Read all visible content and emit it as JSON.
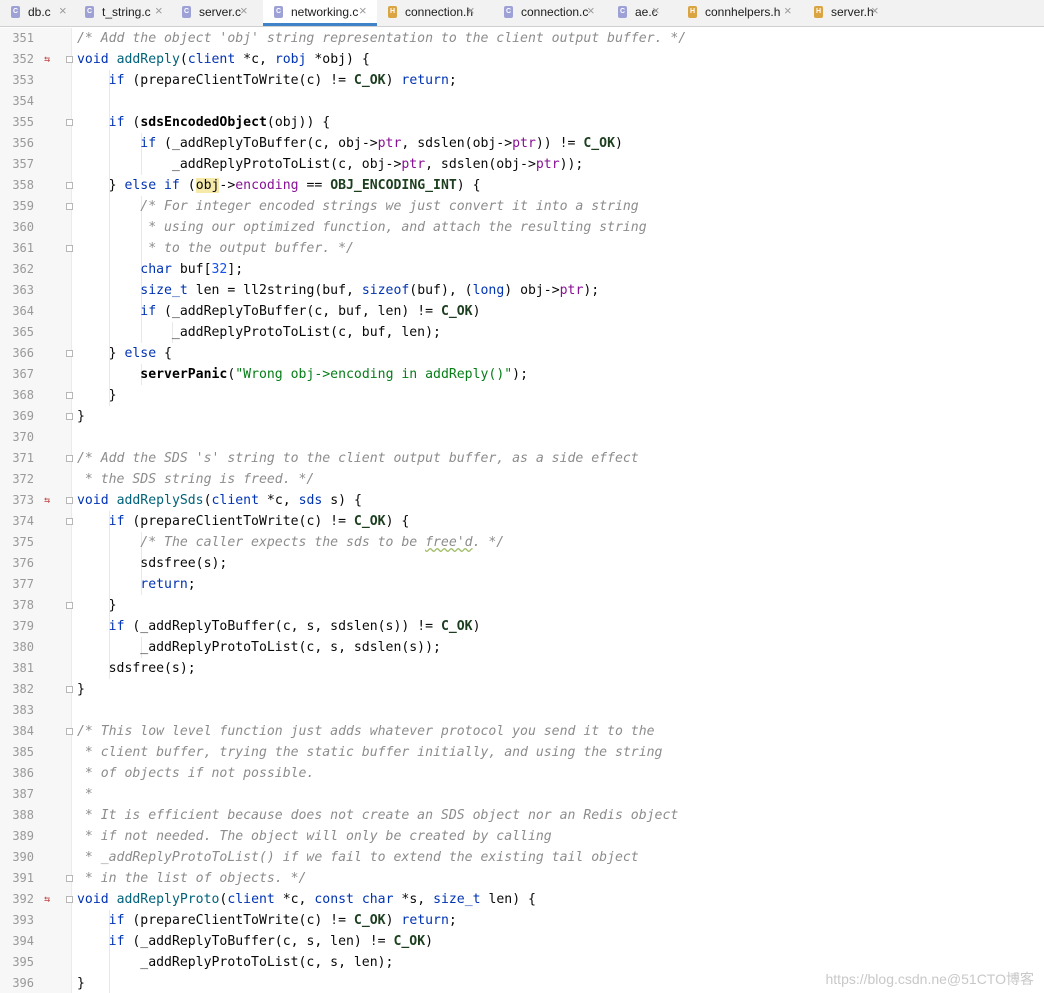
{
  "tabs": [
    {
      "name": "db.c",
      "type": "c",
      "active": false
    },
    {
      "name": "t_string.c",
      "type": "c",
      "active": false
    },
    {
      "name": "server.c",
      "type": "c",
      "active": false
    },
    {
      "name": "networking.c",
      "type": "c",
      "active": true
    },
    {
      "name": "connection.h",
      "type": "h",
      "active": false
    },
    {
      "name": "connection.c",
      "type": "c",
      "active": false
    },
    {
      "name": "ae.c",
      "type": "c",
      "active": false
    },
    {
      "name": "connhelpers.h",
      "type": "h",
      "active": false
    },
    {
      "name": "server.h",
      "type": "h",
      "active": false
    }
  ],
  "tab_close_glyph": "×",
  "file_type_letters": {
    "c": "C",
    "h": "H"
  },
  "gutter": {
    "override_lines": [
      352,
      373,
      392
    ],
    "override_glyph": "⇆",
    "fold_lines": [
      352,
      355,
      358,
      359,
      361,
      366,
      368,
      369,
      371,
      373,
      374,
      378,
      382,
      384,
      391,
      392
    ]
  },
  "indent_guides": [
    {
      "level": 1,
      "from": 353,
      "to": 368
    },
    {
      "level": 2,
      "from": 356,
      "to": 357
    },
    {
      "level": 2,
      "from": 359,
      "to": 365
    },
    {
      "level": 3,
      "from": 365,
      "to": 365
    },
    {
      "level": 2,
      "from": 367,
      "to": 367
    },
    {
      "level": 1,
      "from": 374,
      "to": 381
    },
    {
      "level": 2,
      "from": 375,
      "to": 377
    },
    {
      "level": 2,
      "from": 380,
      "to": 380
    },
    {
      "level": 1,
      "from": 393,
      "to": 396
    }
  ],
  "code_lines": [
    {
      "n": 351,
      "s": [
        [
          "cm",
          "/* Add the object 'obj' string representation to the client output buffer. */"
        ]
      ]
    },
    {
      "n": 352,
      "s": [
        [
          "kw",
          "void "
        ],
        [
          "fn",
          "addReply"
        ],
        [
          "",
          "("
        ],
        [
          "kw",
          "client "
        ],
        [
          "",
          "*c, "
        ],
        [
          "kw",
          "robj "
        ],
        [
          "",
          "*obj) {"
        ]
      ]
    },
    {
      "n": 353,
      "s": [
        [
          "",
          "    "
        ],
        [
          "kw",
          "if "
        ],
        [
          "",
          "(prepareClientToWrite(c) != "
        ],
        [
          "mc",
          "C_OK"
        ],
        [
          "",
          ") "
        ],
        [
          "kw",
          "return"
        ],
        [
          "",
          ";"
        ]
      ]
    },
    {
      "n": 354,
      "s": [
        [
          "",
          ""
        ]
      ]
    },
    {
      "n": 355,
      "s": [
        [
          "",
          "    "
        ],
        [
          "kw",
          "if "
        ],
        [
          "",
          "("
        ],
        [
          "bd",
          "sdsEncodedObject"
        ],
        [
          "",
          "(obj)) {"
        ]
      ]
    },
    {
      "n": 356,
      "s": [
        [
          "",
          "        "
        ],
        [
          "kw",
          "if "
        ],
        [
          "",
          "(_addReplyToBuffer(c, obj->"
        ],
        [
          "fd",
          "ptr"
        ],
        [
          "",
          ", sdslen(obj->"
        ],
        [
          "fd",
          "ptr"
        ],
        [
          "",
          ")) != "
        ],
        [
          "mc",
          "C_OK"
        ],
        [
          "",
          ")"
        ]
      ]
    },
    {
      "n": 357,
      "s": [
        [
          "",
          "            _addReplyProtoToList(c, obj->"
        ],
        [
          "fd",
          "ptr"
        ],
        [
          "",
          ", sdslen(obj->"
        ],
        [
          "fd",
          "ptr"
        ],
        [
          "",
          "));"
        ]
      ]
    },
    {
      "n": 358,
      "s": [
        [
          "",
          "    } "
        ],
        [
          "kw",
          "else if "
        ],
        [
          "",
          "("
        ],
        [
          "hl",
          "obj"
        ],
        [
          "",
          "->"
        ],
        [
          "fd",
          "encoding"
        ],
        [
          "",
          " == "
        ],
        [
          "mc",
          "OBJ_ENCODING_INT"
        ],
        [
          "",
          ") {"
        ]
      ]
    },
    {
      "n": 359,
      "s": [
        [
          "",
          "        "
        ],
        [
          "cm",
          "/* For integer encoded strings we just convert it into a string"
        ]
      ]
    },
    {
      "n": 360,
      "s": [
        [
          "cm",
          "         * using our optimized function, and attach the resulting string"
        ]
      ]
    },
    {
      "n": 361,
      "s": [
        [
          "cm",
          "         * to the output buffer. */"
        ]
      ]
    },
    {
      "n": 362,
      "s": [
        [
          "",
          "        "
        ],
        [
          "kw",
          "char "
        ],
        [
          "",
          "buf["
        ],
        [
          "nm",
          "32"
        ],
        [
          "",
          "];"
        ]
      ]
    },
    {
      "n": 363,
      "s": [
        [
          "",
          "        "
        ],
        [
          "kw",
          "size_t "
        ],
        [
          "",
          "len = ll2string(buf, "
        ],
        [
          "kw",
          "sizeof"
        ],
        [
          "",
          "(buf), ("
        ],
        [
          "kw",
          "long"
        ],
        [
          "",
          ") obj->"
        ],
        [
          "fd",
          "ptr"
        ],
        [
          "",
          ");"
        ]
      ]
    },
    {
      "n": 364,
      "s": [
        [
          "",
          "        "
        ],
        [
          "kw",
          "if "
        ],
        [
          "",
          "(_addReplyToBuffer(c, buf, len) != "
        ],
        [
          "mc",
          "C_OK"
        ],
        [
          "",
          ")"
        ]
      ]
    },
    {
      "n": 365,
      "s": [
        [
          "",
          "            _addReplyProtoToList(c, buf, len);"
        ]
      ]
    },
    {
      "n": 366,
      "s": [
        [
          "",
          "    } "
        ],
        [
          "kw",
          "else "
        ],
        [
          "",
          "{"
        ]
      ]
    },
    {
      "n": 367,
      "s": [
        [
          "",
          "        "
        ],
        [
          "bd",
          "serverPanic"
        ],
        [
          "",
          "("
        ],
        [
          "st",
          "\"Wrong obj->encoding in addReply()\""
        ],
        [
          "",
          ");"
        ]
      ]
    },
    {
      "n": 368,
      "s": [
        [
          "",
          "    }"
        ]
      ]
    },
    {
      "n": 369,
      "s": [
        [
          "",
          "}"
        ]
      ]
    },
    {
      "n": 370,
      "s": [
        [
          "",
          ""
        ]
      ]
    },
    {
      "n": 371,
      "s": [
        [
          "cm",
          "/* Add the SDS 's' string to the client output buffer, as a side effect"
        ]
      ]
    },
    {
      "n": 372,
      "s": [
        [
          "cm",
          " * the SDS string is freed. */"
        ]
      ]
    },
    {
      "n": 373,
      "s": [
        [
          "kw",
          "void "
        ],
        [
          "fn",
          "addReplySds"
        ],
        [
          "",
          "("
        ],
        [
          "kw",
          "client "
        ],
        [
          "",
          "*c, "
        ],
        [
          "kw",
          "sds "
        ],
        [
          "",
          "s) {"
        ]
      ]
    },
    {
      "n": 374,
      "s": [
        [
          "",
          "    "
        ],
        [
          "kw",
          "if "
        ],
        [
          "",
          "(prepareClientToWrite(c) != "
        ],
        [
          "mc",
          "C_OK"
        ],
        [
          "",
          ") {"
        ]
      ]
    },
    {
      "n": 375,
      "s": [
        [
          "",
          "        "
        ],
        [
          "cm",
          "/* The caller expects the sds to be "
        ],
        [
          "cm sq",
          "free'd"
        ],
        [
          "cm",
          ". */"
        ]
      ]
    },
    {
      "n": 376,
      "s": [
        [
          "",
          "        sdsfree(s);"
        ]
      ]
    },
    {
      "n": 377,
      "s": [
        [
          "",
          "        "
        ],
        [
          "kw",
          "return"
        ],
        [
          "",
          ";"
        ]
      ]
    },
    {
      "n": 378,
      "s": [
        [
          "",
          "    }"
        ]
      ]
    },
    {
      "n": 379,
      "s": [
        [
          "",
          "    "
        ],
        [
          "kw",
          "if "
        ],
        [
          "",
          "(_addReplyToBuffer(c, s, sdslen(s)) != "
        ],
        [
          "mc",
          "C_OK"
        ],
        [
          "",
          ")"
        ]
      ]
    },
    {
      "n": 380,
      "s": [
        [
          "",
          "        _addReplyProtoToList(c, s, sdslen(s));"
        ]
      ]
    },
    {
      "n": 381,
      "s": [
        [
          "",
          "    sdsfree(s);"
        ]
      ]
    },
    {
      "n": 382,
      "s": [
        [
          "",
          "}"
        ]
      ]
    },
    {
      "n": 383,
      "s": [
        [
          "",
          ""
        ]
      ]
    },
    {
      "n": 384,
      "s": [
        [
          "cm",
          "/* This low level function just adds whatever protocol you send it to the"
        ]
      ]
    },
    {
      "n": 385,
      "s": [
        [
          "cm",
          " * client buffer, trying the static buffer initially, and using the string"
        ]
      ]
    },
    {
      "n": 386,
      "s": [
        [
          "cm",
          " * of objects if not possible."
        ]
      ]
    },
    {
      "n": 387,
      "s": [
        [
          "cm",
          " *"
        ]
      ]
    },
    {
      "n": 388,
      "s": [
        [
          "cm",
          " * It is efficient because does not create an SDS object nor an Redis object"
        ]
      ]
    },
    {
      "n": 389,
      "s": [
        [
          "cm",
          " * if not needed. The object will only be created by calling"
        ]
      ]
    },
    {
      "n": 390,
      "s": [
        [
          "cm",
          " * _addReplyProtoToList() if we fail to extend the existing tail object"
        ]
      ]
    },
    {
      "n": 391,
      "s": [
        [
          "cm",
          " * in the list of objects. */"
        ]
      ]
    },
    {
      "n": 392,
      "s": [
        [
          "kw",
          "void "
        ],
        [
          "fn",
          "addReplyProto"
        ],
        [
          "",
          "("
        ],
        [
          "kw",
          "client "
        ],
        [
          "",
          "*c, "
        ],
        [
          "kw",
          "const char "
        ],
        [
          "",
          "*s, "
        ],
        [
          "kw",
          "size_t "
        ],
        [
          "",
          "len) {"
        ]
      ]
    },
    {
      "n": 393,
      "s": [
        [
          "",
          "    "
        ],
        [
          "kw",
          "if "
        ],
        [
          "",
          "(prepareClientToWrite(c) != "
        ],
        [
          "mc",
          "C_OK"
        ],
        [
          "",
          ") "
        ],
        [
          "kw",
          "return"
        ],
        [
          "",
          ";"
        ]
      ]
    },
    {
      "n": 394,
      "s": [
        [
          "",
          "    "
        ],
        [
          "kw",
          "if "
        ],
        [
          "",
          "(_addReplyToBuffer(c, s, len) != "
        ],
        [
          "mc",
          "C_OK"
        ],
        [
          "",
          ")"
        ]
      ]
    },
    {
      "n": 395,
      "s": [
        [
          "",
          "        _addReplyProtoToList(c, s, len);"
        ]
      ]
    },
    {
      "n": 396,
      "s": [
        [
          "",
          "}"
        ]
      ]
    }
  ],
  "watermark": "https://blog.csdn.ne@51CTO博客"
}
